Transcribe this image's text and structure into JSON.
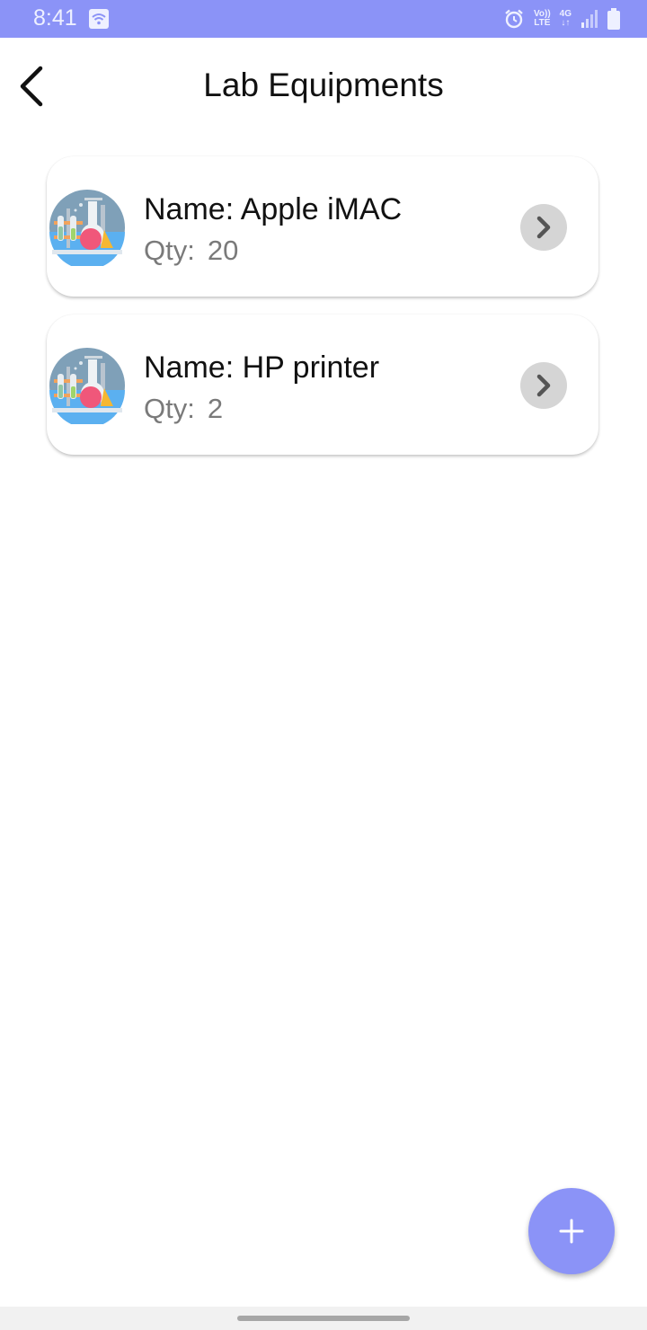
{
  "status_bar": {
    "time": "8:41",
    "wifi_icon": "wifi-icon",
    "alarm_icon": "alarm-icon",
    "volte_top": "Vo))",
    "volte_bottom": "LTE",
    "network_top": "4G",
    "network_bottom": "↓↑",
    "signal_icon": "signal-icon",
    "battery_icon": "battery-icon",
    "background_color": "#8b93f7"
  },
  "header": {
    "back_icon": "back-arrow-icon",
    "title": "Lab Equipments"
  },
  "equipment_list": [
    {
      "name_prefix": "Name: ",
      "name": "Apple iMAC",
      "qty_label": "Qty:",
      "qty": "20",
      "icon": "lab-equipment-icon",
      "action_icon": "chevron-right-icon"
    },
    {
      "name_prefix": "Name: ",
      "name": "HP printer",
      "qty_label": "Qty:",
      "qty": "2",
      "icon": "lab-equipment-icon",
      "action_icon": "chevron-right-icon"
    }
  ],
  "fab": {
    "icon": "plus-icon",
    "color": "#8b93f7"
  }
}
